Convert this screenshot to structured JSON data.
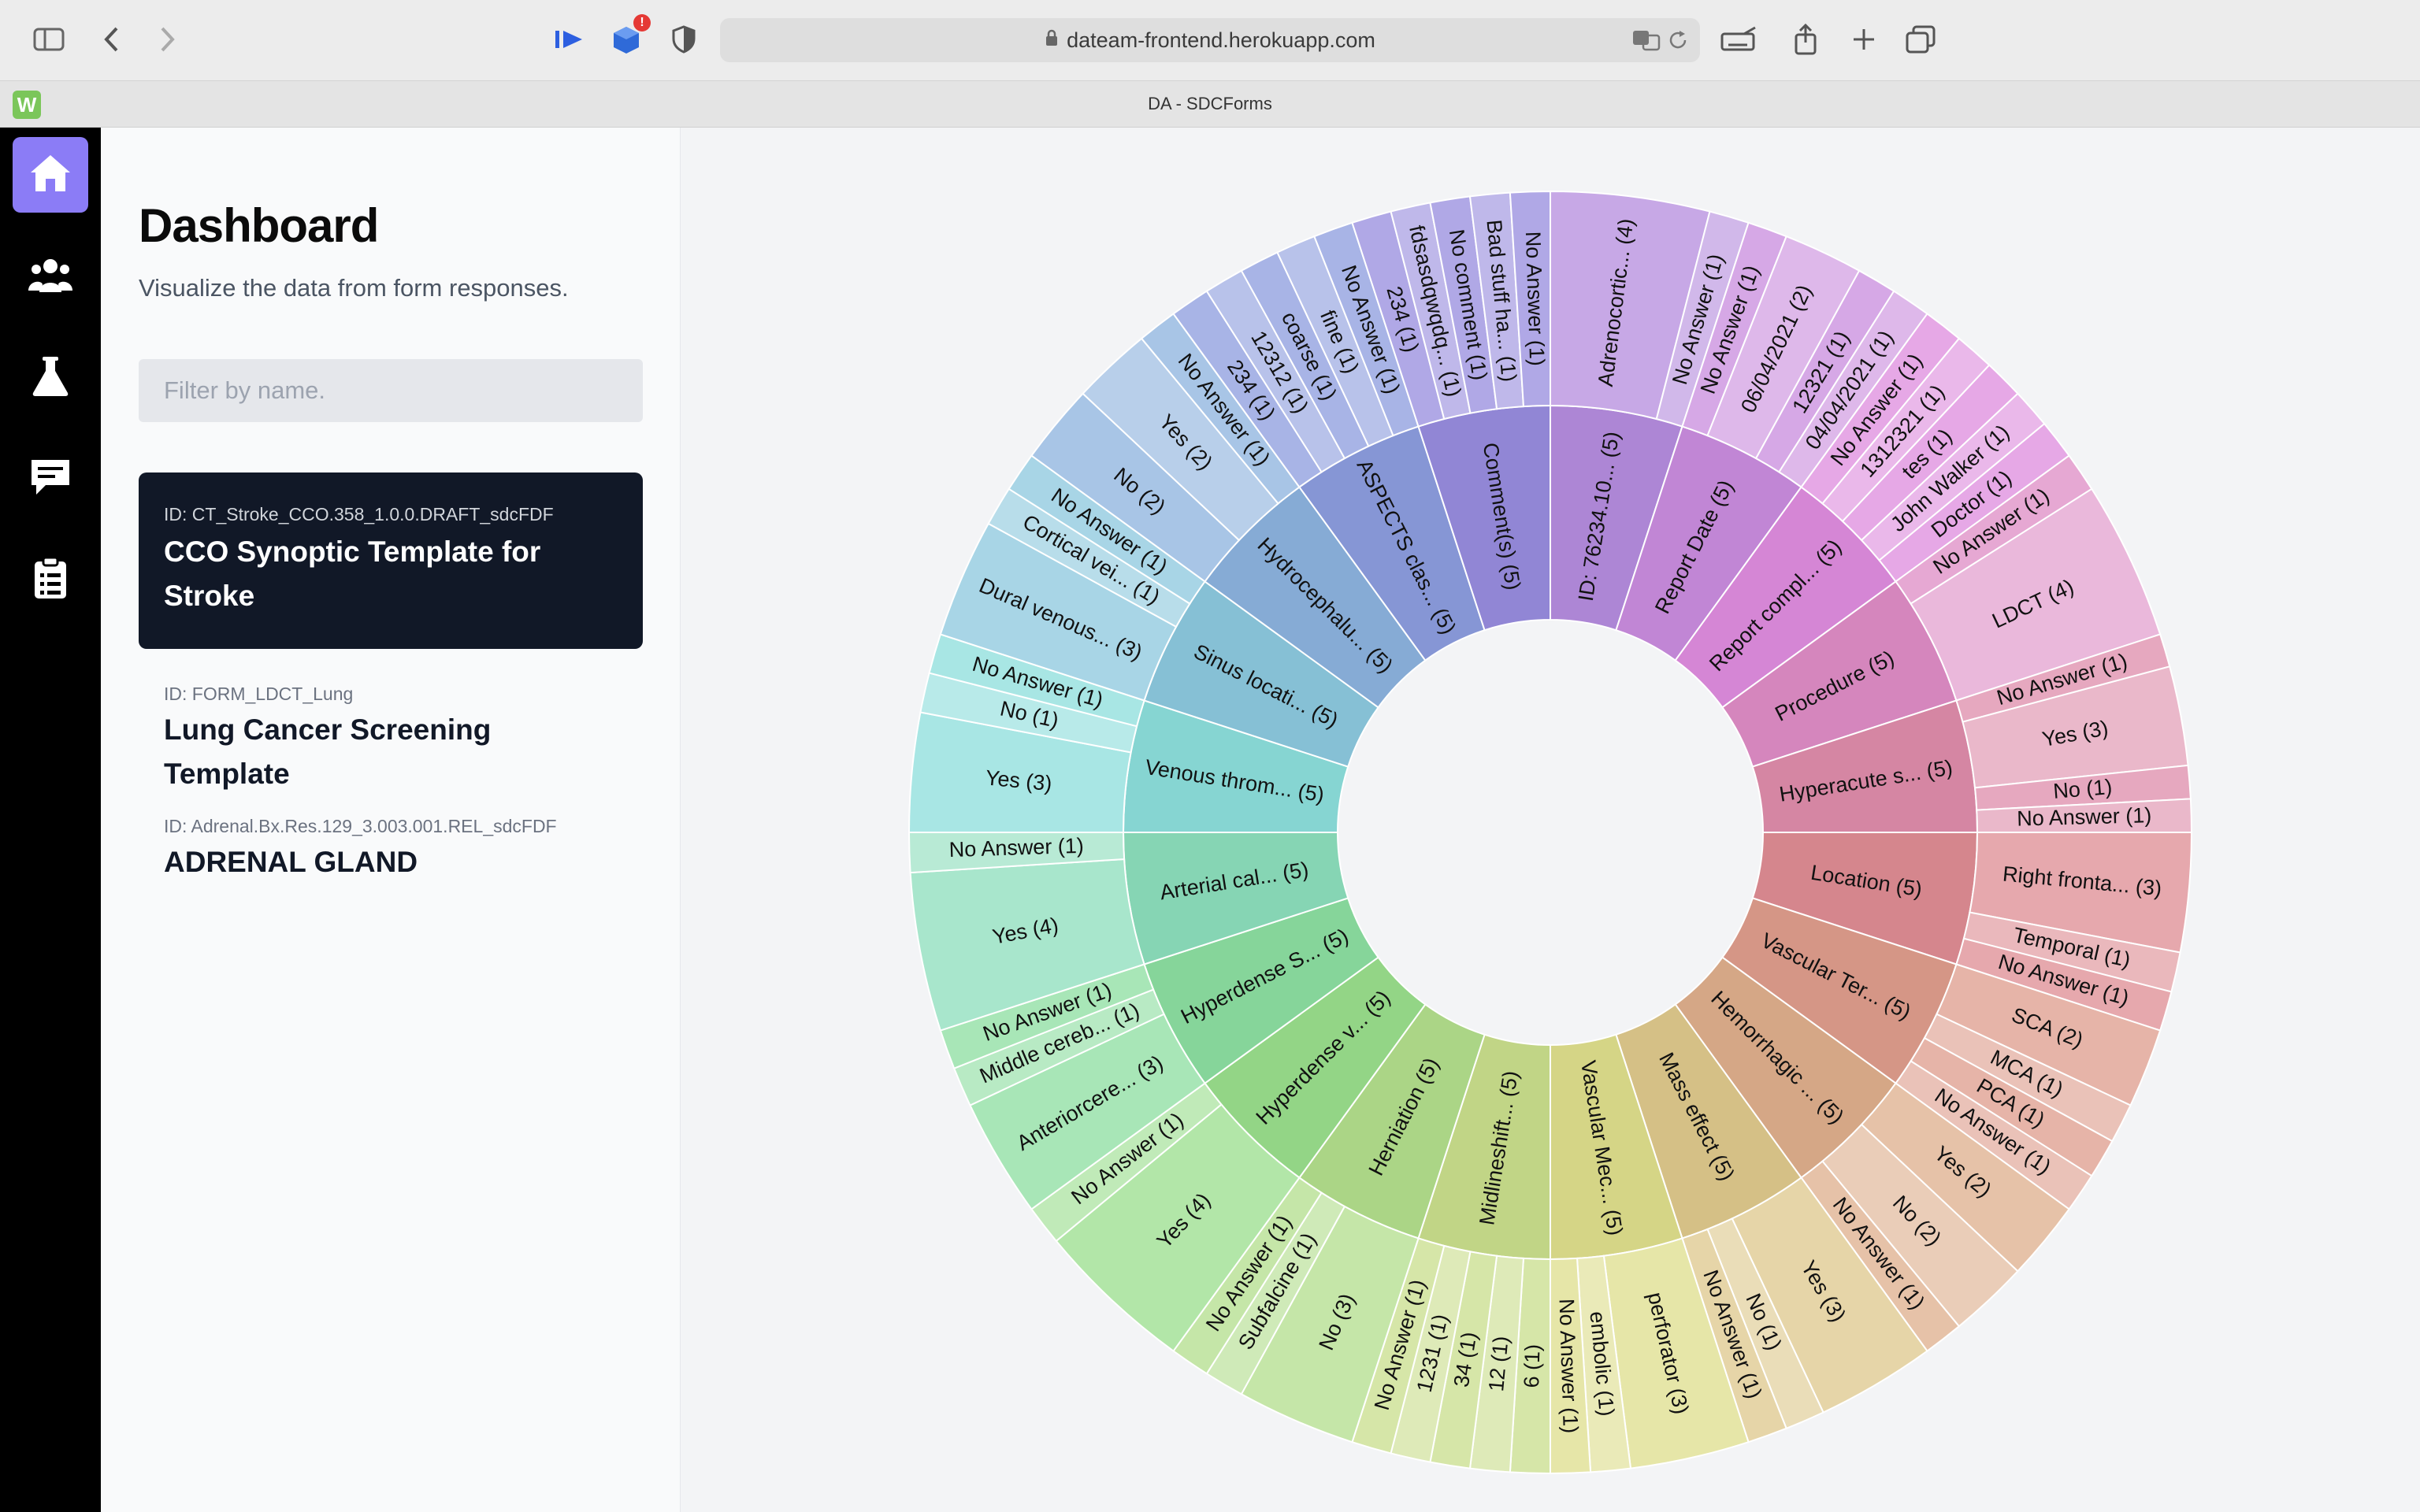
{
  "browser": {
    "url": "dateam-frontend.herokuapp.com",
    "tab_title": "DA - SDCForms",
    "favicon_letter": "W",
    "extension_badge": "!",
    "icons": [
      "sidebar-toggle-icon",
      "back-icon",
      "forward-icon",
      "media-icon",
      "extension-cube-icon",
      "shield-icon",
      "lock-icon",
      "translate-icon",
      "reload-icon",
      "keyboard-icon",
      "share-icon",
      "new-tab-icon",
      "tabs-overview-icon"
    ]
  },
  "rail": {
    "items": [
      {
        "name": "home",
        "icon": "home-icon",
        "active": true
      },
      {
        "name": "users",
        "icon": "users-icon",
        "active": false
      },
      {
        "name": "lab",
        "icon": "flask-icon",
        "active": false
      },
      {
        "name": "messages",
        "icon": "chat-icon",
        "active": false
      },
      {
        "name": "forms",
        "icon": "clipboard-icon",
        "active": false
      }
    ]
  },
  "dashboard": {
    "title": "Dashboard",
    "subtitle": "Visualize the data from form responses.",
    "filter_placeholder": "Filter by name."
  },
  "forms": [
    {
      "id_label": "ID: CT_Stroke_CCO.358_1.0.0.DRAFT_sdcFDF",
      "name": "CCO Synoptic Template for Stroke",
      "selected": true
    },
    {
      "id_label": "ID: FORM_LDCT_Lung",
      "name": "Lung Cancer Screening Template",
      "selected": false
    },
    {
      "id_label": "ID: Adrenal.Bx.Res.129_3.003.001.REL_sdcFDF",
      "name": "ADRENAL GLAND",
      "selected": false
    }
  ],
  "chart_data": {
    "type": "sunburst",
    "root": {
      "label": "ID: 76234.10... (5)",
      "value": 5
    },
    "questions": [
      {
        "label": "ID: 76234.10... (5)",
        "value": 5,
        "hue": 270,
        "answers": [
          {
            "label": "Adrenocortic... (4)",
            "value": 4
          },
          {
            "label": "No Answer (1)",
            "value": 1
          }
        ]
      },
      {
        "label": "Report Date (5)",
        "value": 5,
        "hue": 285,
        "answers": [
          {
            "label": "No Answer (1)",
            "value": 1
          },
          {
            "label": "06/04/2021 (2)",
            "value": 2
          },
          {
            "label": "12321 (1)",
            "value": 1
          },
          {
            "label": "04/04/2021 (1)",
            "value": 1
          }
        ]
      },
      {
        "label": "Report compl... (5)",
        "value": 5,
        "hue": 300,
        "answers": [
          {
            "label": "No Answer (1)",
            "value": 1
          },
          {
            "label": "1312321 (1)",
            "value": 1
          },
          {
            "label": "tes (1)",
            "value": 1
          },
          {
            "label": "John Walker (1)",
            "value": 1
          },
          {
            "label": "Doctor (1)",
            "value": 1
          }
        ]
      },
      {
        "label": "Procedure (5)",
        "value": 5,
        "hue": 318,
        "answers": [
          {
            "label": "No Answer (1)",
            "value": 1
          },
          {
            "label": "LDCT (4)",
            "value": 4
          }
        ]
      },
      {
        "label": "Hyperacute s... (5)",
        "value": 5,
        "hue": 338,
        "answers": [
          {
            "label": "No Answer (1)",
            "value": 1
          },
          {
            "label": "Yes (3)",
            "value": 3
          },
          {
            "label": "No (1)",
            "value": 1
          },
          {
            "label": "No Answer (1)",
            "value": 1
          }
        ]
      },
      {
        "label": "Location (5)",
        "value": 5,
        "hue": 355,
        "answers": [
          {
            "label": "Right fronta... (3)",
            "value": 3
          },
          {
            "label": "Temporal (1)",
            "value": 1
          },
          {
            "label": "No Answer (1)",
            "value": 1
          }
        ]
      },
      {
        "label": "Vascular Ter... (5)",
        "value": 5,
        "hue": 12,
        "answers": [
          {
            "label": "SCA (2)",
            "value": 2
          },
          {
            "label": "MCA (1)",
            "value": 1
          },
          {
            "label": "PCA (1)",
            "value": 1
          },
          {
            "label": "No Answer (1)",
            "value": 1
          }
        ]
      },
      {
        "label": "Hemorrhagic ... (5)",
        "value": 5,
        "hue": 25,
        "answers": [
          {
            "label": "Yes (2)",
            "value": 2
          },
          {
            "label": "No (2)",
            "value": 2
          },
          {
            "label": "No Answer (1)",
            "value": 1
          }
        ]
      },
      {
        "label": "Mass effect (5)",
        "value": 5,
        "hue": 44,
        "answers": [
          {
            "label": "Yes (3)",
            "value": 3
          },
          {
            "label": "No (1)",
            "value": 1
          },
          {
            "label": "No Answer (1)",
            "value": 1
          }
        ]
      },
      {
        "label": "Vascular Mec... (5)",
        "value": 5,
        "hue": 60,
        "answers": [
          {
            "label": "perforator (3)",
            "value": 3
          },
          {
            "label": "embolic (1)",
            "value": 1
          },
          {
            "label": "No Answer (1)",
            "value": 1
          }
        ]
      },
      {
        "label": "Midlineshift... (5)",
        "value": 5,
        "hue": 75,
        "answers": [
          {
            "label": "6 (1)",
            "value": 1
          },
          {
            "label": "12 (1)",
            "value": 1
          },
          {
            "label": "34 (1)",
            "value": 1
          },
          {
            "label": "1231 (1)",
            "value": 1
          },
          {
            "label": "No Answer (1)",
            "value": 1
          }
        ]
      },
      {
        "label": "Herniation (5)",
        "value": 5,
        "hue": 92,
        "answers": [
          {
            "label": "No (3)",
            "value": 3
          },
          {
            "label": "Subfalcine (1)",
            "value": 1
          },
          {
            "label": "No Answer (1)",
            "value": 1
          }
        ]
      },
      {
        "label": "Hyperdense v... (5)",
        "value": 5,
        "hue": 110,
        "answers": [
          {
            "label": "Yes (4)",
            "value": 4
          },
          {
            "label": "No Answer (1)",
            "value": 1
          }
        ]
      },
      {
        "label": "Hyperdense S... (5)",
        "value": 5,
        "hue": 135,
        "answers": [
          {
            "label": "Anteriorcere... (3)",
            "value": 3
          },
          {
            "label": "Middle cereb... (1)",
            "value": 1
          },
          {
            "label": "No Answer (1)",
            "value": 1
          }
        ]
      },
      {
        "label": "Arterial cal... (5)",
        "value": 5,
        "hue": 155,
        "answers": [
          {
            "label": "Yes (4)",
            "value": 4
          },
          {
            "label": "No Answer (1)",
            "value": 1
          }
        ]
      },
      {
        "label": "Venous throm... (5)",
        "value": 5,
        "hue": 178,
        "answers": [
          {
            "label": "Yes (3)",
            "value": 3
          },
          {
            "label": "No (1)",
            "value": 1
          },
          {
            "label": "No Answer (1)",
            "value": 1
          }
        ]
      },
      {
        "label": "Sinus locati... (5)",
        "value": 5,
        "hue": 196,
        "answers": [
          {
            "label": "Dural venous... (3)",
            "value": 3
          },
          {
            "label": "Cortical vei... (1)",
            "value": 1
          },
          {
            "label": "No Answer (1)",
            "value": 1
          }
        ]
      },
      {
        "label": "Hydrocephalu... (5)",
        "value": 5,
        "hue": 212,
        "answers": [
          {
            "label": "No (2)",
            "value": 2
          },
          {
            "label": "Yes (2)",
            "value": 2
          },
          {
            "label": "No Answer (1)",
            "value": 1
          }
        ]
      },
      {
        "label": "ASPECTS clas... (5)",
        "value": 5,
        "hue": 228,
        "answers": [
          {
            "label": "234 (1)",
            "value": 1
          },
          {
            "label": "12312 (1)",
            "value": 1
          },
          {
            "label": "coarse (1)",
            "value": 1
          },
          {
            "label": "fine (1)",
            "value": 1
          },
          {
            "label": "No Answer (1)",
            "value": 1
          }
        ]
      },
      {
        "label": "Comment(s) (5)",
        "value": 5,
        "hue": 248,
        "answers": [
          {
            "label": "234 (1)",
            "value": 1
          },
          {
            "label": "fdsasdqwqdq... (1)",
            "value": 1
          },
          {
            "label": "No comment (1)",
            "value": 1
          },
          {
            "label": "Bad stuff ha... (1)",
            "value": 1
          },
          {
            "label": "No Answer (1)",
            "value": 1
          }
        ]
      }
    ]
  }
}
